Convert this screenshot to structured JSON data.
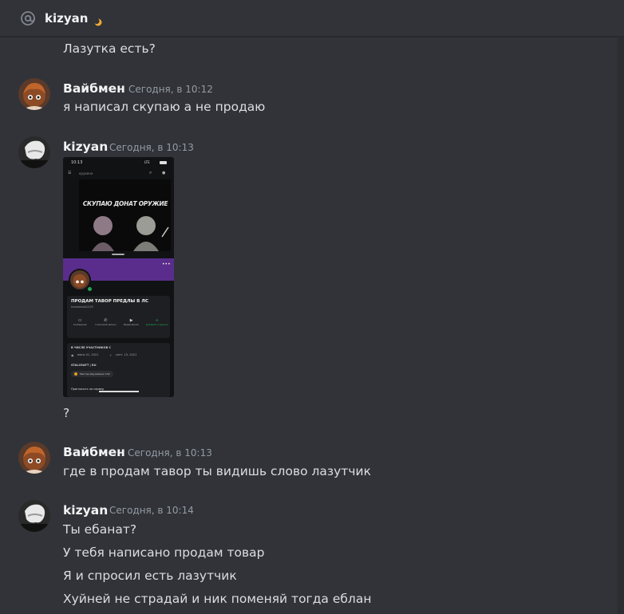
{
  "header": {
    "title": "kizyan",
    "status_icon": "moon-icon",
    "accent": "#f0a832"
  },
  "messages": [
    {
      "text": "Лазутка есть?"
    },
    {
      "author": "Вайбмен",
      "timestamp": "Сегодня, в 10:12",
      "text": "я написал скупаю а не продаю"
    },
    {
      "author": "kizyan",
      "timestamp": "Сегодня, в 10:13",
      "attachment": {
        "time": "10:13",
        "status": "LTE",
        "channel": "крукина",
        "banner_text": "СКУПАЮ ДОНАТ ОРУЖИЕ",
        "profile_name": "ПРОДАМ ТАВОР ПРЕДЛЫ В ЛС",
        "profile_sub": "kramenkat1229",
        "actions": [
          "Сообщение",
          "Голосовой звонок",
          "Видеозвонок",
          "Добавить в друзья"
        ],
        "info_heading": "В ЧИСЛЕ УЧАСТНИКОВ С",
        "date_discord": "июнь 01, 2021",
        "date_server": "сент. 15, 2021",
        "roles_heading": "STALCRAFT | RU",
        "role": "Мастер-Оружейник 102",
        "invite": "Пригласить на сервер"
      },
      "text": "?"
    },
    {
      "author": "Вайбмен",
      "timestamp": "Сегодня, в 10:13",
      "text": "где в продам тавор ты видишь слово лазутчик"
    },
    {
      "author": "kizyan",
      "timestamp": "Сегодня, в 10:14",
      "lines": [
        "Ты ебанат?",
        "У тебя написано продам товар",
        "Я и спросил есть лазутчик",
        "Хуйней не страдай и ник поменяй тогда еблан"
      ]
    }
  ]
}
